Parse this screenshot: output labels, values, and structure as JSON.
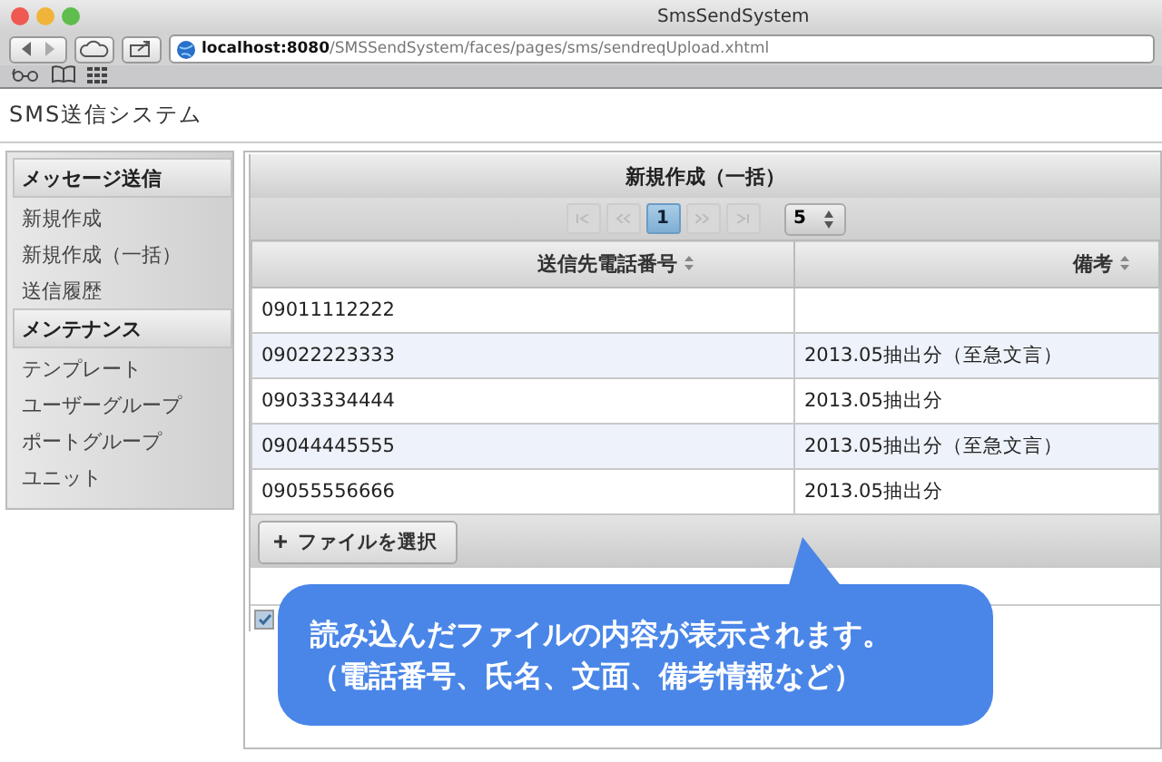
{
  "window": {
    "title": "SmsSendSystem"
  },
  "address_bar": {
    "host": "localhost:8080",
    "path": "/SMSSendSystem/faces/pages/sms/sendreqUpload.xhtml"
  },
  "app_title": "SMS送信システム",
  "sidebar": {
    "sections": [
      {
        "header": "メッセージ送信",
        "items": [
          "新規作成",
          "新規作成（一括）",
          "送信履歴"
        ]
      },
      {
        "header": "メンテナンス",
        "items": [
          "テンプレート",
          "ユーザーグループ",
          "ポートグループ",
          "ユニット"
        ]
      }
    ]
  },
  "panel": {
    "title": "新規作成（一括）",
    "paginator": {
      "pages": [
        {
          "label": "1",
          "selected": true
        }
      ],
      "rows_per_page": "5"
    },
    "table": {
      "columns": [
        "送信先電話番号",
        "備考"
      ],
      "rows": [
        [
          "09011112222",
          ""
        ],
        [
          "09022223333",
          "2013.05抽出分（至急文言）"
        ],
        [
          "09033334444",
          "2013.05抽出分"
        ],
        [
          "09044445555",
          "2013.05抽出分（至急文言）"
        ],
        [
          "09055556666",
          "2013.05抽出分"
        ]
      ]
    },
    "upload_button": "ファイルを選択",
    "checkbox": {
      "checked": true
    }
  },
  "callout": {
    "lines": [
      "読み込んだファイルの内容が表示されます。",
      "（電話番号、氏名、文面、備考情報など）"
    ]
  }
}
